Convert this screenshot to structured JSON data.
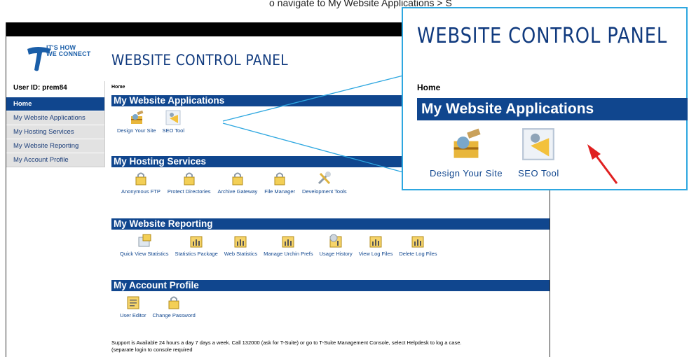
{
  "top_text": "o navigate to My Website Applications > S",
  "logo": {
    "tagline_line1": "IT'S HOW",
    "tagline_line2": "WE CONNECT"
  },
  "header": {
    "title": "WEBSITE CONTROL PANEL"
  },
  "sidebar": {
    "user_id": "User ID: prem84",
    "items": [
      {
        "label": "Home",
        "active": true
      },
      {
        "label": "My Website Applications"
      },
      {
        "label": "My Hosting Services"
      },
      {
        "label": "My Website Reporting"
      },
      {
        "label": "My Account Profile"
      }
    ]
  },
  "breadcrumb": "Home",
  "sections": {
    "apps": {
      "title": "My Website Applications",
      "items": [
        {
          "label": "Design Your Site",
          "icon": "design-site-icon"
        },
        {
          "label": "SEO Tool",
          "icon": "seo-tool-icon"
        }
      ]
    },
    "hosting": {
      "title": "My Hosting Services",
      "items": [
        {
          "label": "Anonymous FTP",
          "icon": "lock-icon"
        },
        {
          "label": "Protect Directories",
          "icon": "lock-icon"
        },
        {
          "label": "Archive Gateway",
          "icon": "lock-icon"
        },
        {
          "label": "File Manager",
          "icon": "lock-icon"
        },
        {
          "label": "Development Tools",
          "icon": "tools-icon"
        }
      ]
    },
    "reporting": {
      "title": "My Website Reporting",
      "items": [
        {
          "label": "Quick View Statistics",
          "icon": "stats-window-icon"
        },
        {
          "label": "Statistics Package",
          "icon": "chart-icon"
        },
        {
          "label": "Web Statistics",
          "icon": "chart-icon"
        },
        {
          "label": "Manage Urchin Prefs",
          "icon": "chart-icon"
        },
        {
          "label": "Usage History",
          "icon": "gear-chart-icon"
        },
        {
          "label": "View Log Files",
          "icon": "chart-icon"
        },
        {
          "label": "Delete Log Files",
          "icon": "chart-icon"
        }
      ]
    },
    "account": {
      "title": "My Account Profile",
      "items": [
        {
          "label": "User Editor",
          "icon": "user-editor-icon"
        },
        {
          "label": "Change Password",
          "icon": "lock-icon"
        }
      ]
    }
  },
  "footer": {
    "line1": "Support is Available 24 hours a day 7 days a week. Call 132000 (ask for T-Suite) or go to T-Suite Management Console, select Helpdesk to log a case.",
    "line2": "(separate login to console required"
  },
  "zoom": {
    "title": "WEBSITE CONTROL PANEL",
    "breadcrumb": "Home",
    "section_title": "My Website Applications",
    "items": [
      {
        "label": "Design Your Site"
      },
      {
        "label": "SEO Tool"
      }
    ]
  },
  "colors": {
    "brand_blue": "#10468e",
    "zoom_border": "#2ea7e0",
    "arrow": "#e02020"
  }
}
